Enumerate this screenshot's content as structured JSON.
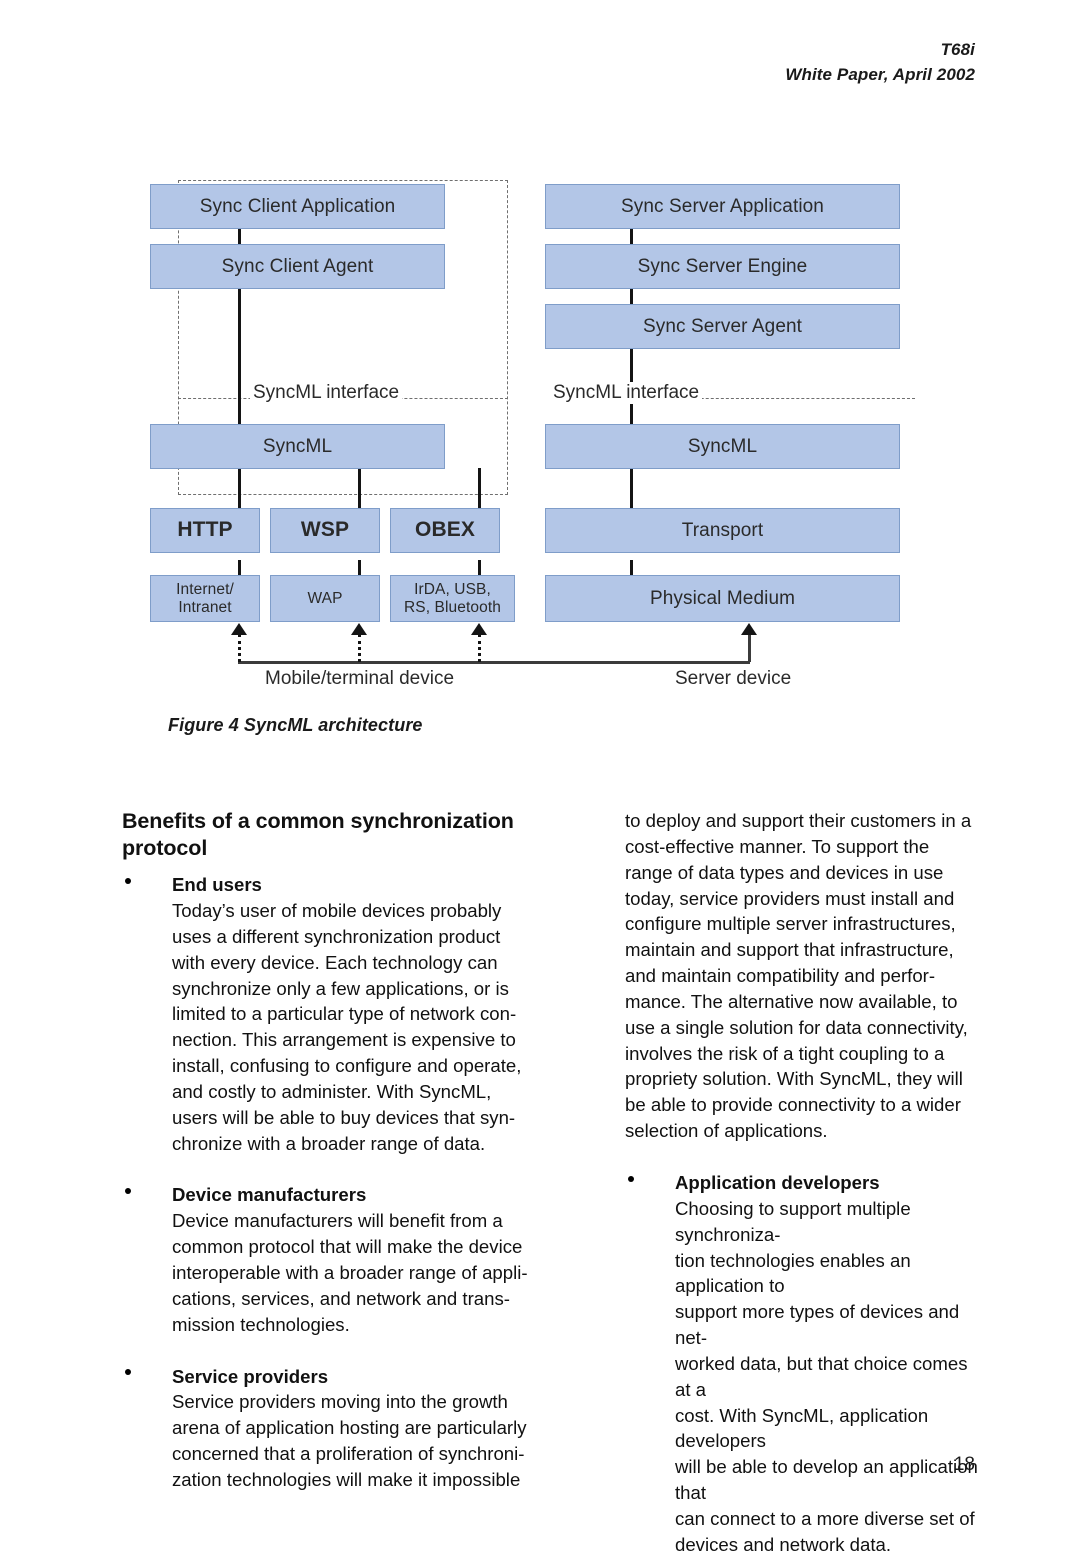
{
  "header": {
    "line1": "T68i",
    "line2": "White Paper, April 2002"
  },
  "figure": {
    "caption": "Figure 4 SyncML architecture",
    "client": {
      "application": "Sync Client Application",
      "agent": "Sync Client Agent",
      "interface_label": "SyncML interface",
      "syncml": "SyncML",
      "transports": [
        "HTTP",
        "WSP",
        "OBEX"
      ],
      "bearers": [
        "Internet/\nIntranet",
        "WAP",
        "IrDA, USB,\nRS, Bluetooth"
      ],
      "device_label": "Mobile/terminal device"
    },
    "server": {
      "application": "Sync Server Application",
      "engine": "Sync Server Engine",
      "agent": "Sync Server Agent",
      "interface_label": "SyncML interface",
      "syncml": "SyncML",
      "transport": "Transport",
      "physical": "Physical Medium",
      "device_label": "Server device"
    },
    "colors": {
      "box_fill": "#b3c6e7",
      "box_border": "#7f9dc9",
      "dashed": "#6f6f6f",
      "connector": "#141414"
    }
  },
  "content": {
    "section_title": "Benefits of a common synchronization protocol",
    "left_bullets": [
      {
        "title": "End users",
        "body": "Today’s user of mobile devices probably\nuses a different synchronization product\nwith every device. Each technology can\nsynchronize only a few applications, or is\nlimited to a particular type of network con-\nnection. This arrangement is expensive to\ninstall, confusing to configure and operate,\nand costly to administer. With SyncML,\nusers will be able to buy devices that syn-\nchronize with a broader range of data."
      },
      {
        "title": "Device manufacturers",
        "body": "Device manufacturers will benefit from a\ncommon protocol that will make the device\ninteroperable with a broader range of appli-\ncations, services, and network and trans-\nmission technologies."
      },
      {
        "title": "Service providers",
        "body": "Service providers moving into the growth\narena of application hosting are particularly\nconcerned that a proliferation of synchroni-\nzation technologies will make it impossible"
      }
    ],
    "right_continuation": "to deploy and support their customers in a\ncost-effective manner. To support the\nrange of data types and devices in use\ntoday, service providers must install and\nconfigure multiple server infrastructures,\nmaintain and support that infrastructure,\nand maintain compatibility and perfor-\nmance. The alternative now available, to\nuse a single solution for data connectivity,\ninvolves the risk of a tight coupling to a\npropriety solution. With SyncML, they will\nbe able to provide connectivity to a wider\nselection of applications.",
    "right_bullets": [
      {
        "title": "Application developers",
        "body": "Choosing to support multiple synchroniza-\ntion technologies enables an application to\nsupport more types of devices and net-\nworked data, but that choice comes at a\ncost. With SyncML, application developers\nwill be able to develop an application that\ncan connect to a more diverse set of\ndevices and network data."
      }
    ]
  },
  "footer": {
    "page_number": "18"
  }
}
